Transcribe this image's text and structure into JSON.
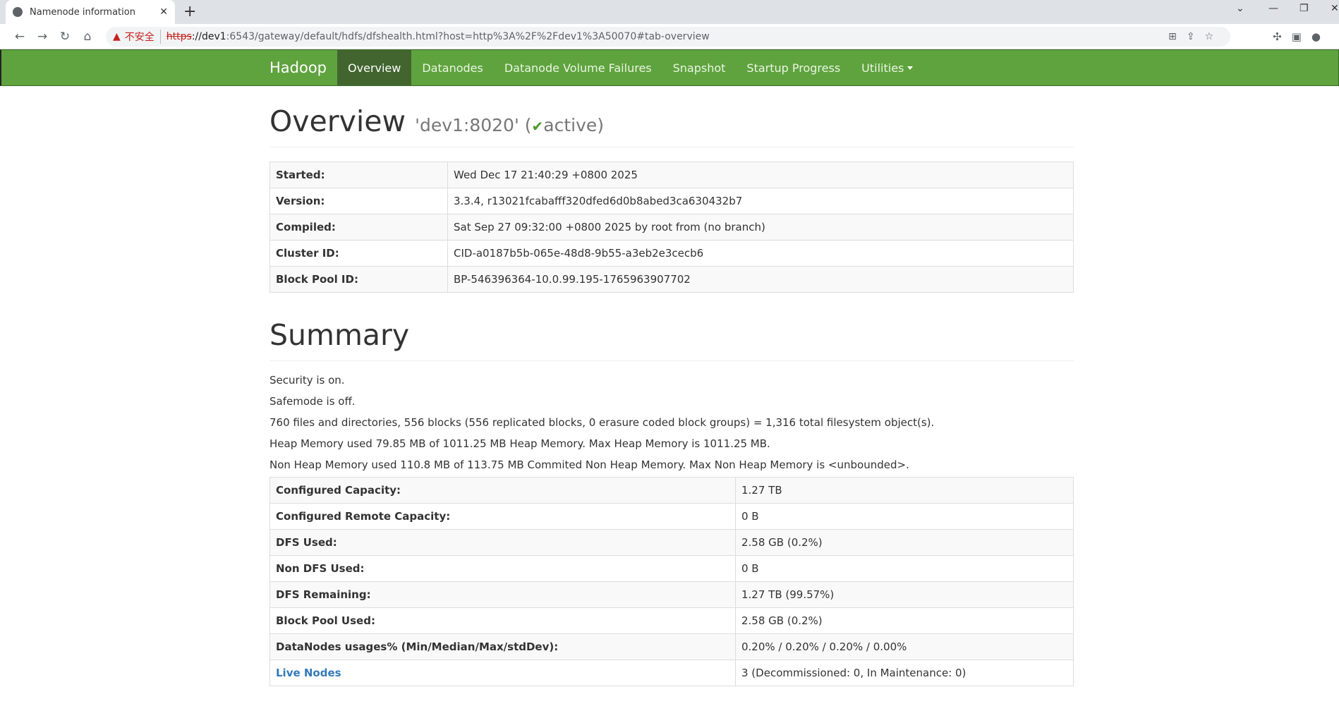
{
  "browser": {
    "tab_title": "Namenode information",
    "insecure_label": "不安全",
    "url_scheme": "https",
    "url_host": "://dev1",
    "url_rest": ":6543/gateway/default/hdfs/dfshealth.html?host=http%3A%2F%2Fdev1%3A50070#tab-overview"
  },
  "navbar": {
    "brand": "Hadoop",
    "items": [
      {
        "label": "Overview"
      },
      {
        "label": "Datanodes"
      },
      {
        "label": "Datanode Volume Failures"
      },
      {
        "label": "Snapshot"
      },
      {
        "label": "Startup Progress"
      },
      {
        "label": "Utilities"
      }
    ]
  },
  "overview": {
    "title": "Overview",
    "host": "'dev1:8020' (",
    "status": "active",
    "close": ")",
    "rows": [
      {
        "k": "Started:",
        "v": "Wed Dec 17 21:40:29 +0800 2025"
      },
      {
        "k": "Version:",
        "v": "3.3.4, r13021fcabafff320dfed6d0b8abed3ca630432b7"
      },
      {
        "k": "Compiled:",
        "v": "Sat Sep 27 09:32:00 +0800 2025 by root from (no branch)"
      },
      {
        "k": "Cluster ID:",
        "v": "CID-a0187b5b-065e-48d8-9b55-a3eb2e3cecb6"
      },
      {
        "k": "Block Pool ID:",
        "v": "BP-546396364-10.0.99.195-1765963907702"
      }
    ]
  },
  "summary": {
    "title": "Summary",
    "lines": [
      "Security is on.",
      "Safemode is off.",
      "760 files and directories, 556 blocks (556 replicated blocks, 0 erasure coded block groups) = 1,316 total filesystem object(s).",
      "Heap Memory used 79.85 MB of 1011.25 MB Heap Memory. Max Heap Memory is 1011.25 MB.",
      "Non Heap Memory used 110.8 MB of 113.75 MB Commited Non Heap Memory. Max Non Heap Memory is <unbounded>."
    ],
    "rows": [
      {
        "k": "Configured Capacity:",
        "v": "1.27 TB"
      },
      {
        "k": "Configured Remote Capacity:",
        "v": "0 B"
      },
      {
        "k": "DFS Used:",
        "v": "2.58 GB (0.2%)"
      },
      {
        "k": "Non DFS Used:",
        "v": "0 B"
      },
      {
        "k": "DFS Remaining:",
        "v": "1.27 TB (99.57%)"
      },
      {
        "k": "Block Pool Used:",
        "v": "2.58 GB (0.2%)"
      },
      {
        "k": "DataNodes usages% (Min/Median/Max/stdDev):",
        "v": "0.20% / 0.20% / 0.20% / 0.00%"
      },
      {
        "k": "Live Nodes",
        "v": "3 (Decommissioned: 0, In Maintenance: 0)",
        "link": true
      }
    ]
  }
}
